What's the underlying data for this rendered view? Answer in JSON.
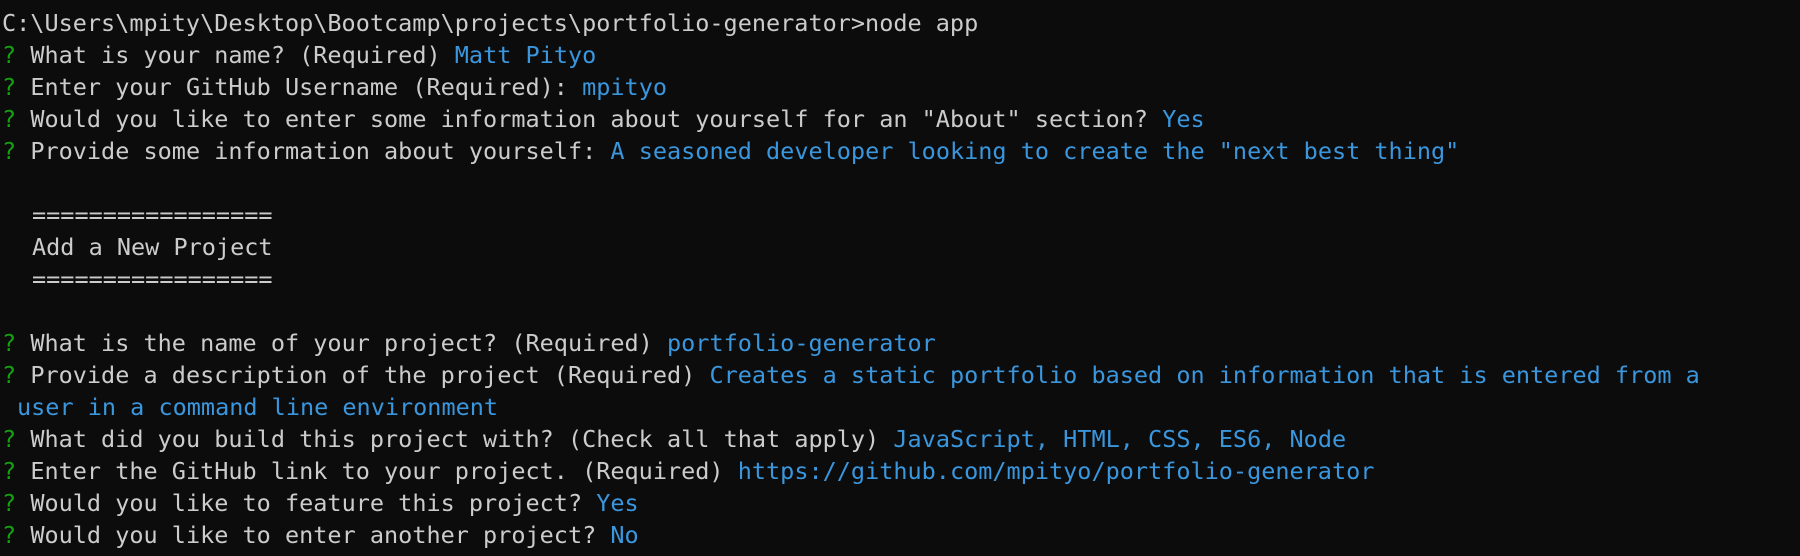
{
  "colors": {
    "background": "#0c0c0c",
    "text": "#cccccc",
    "prompt_marker": "#13a10e",
    "answer": "#3a96dd"
  },
  "terminal": {
    "command_line": "C:\\Users\\mpity\\Desktop\\Bootcamp\\projects\\portfolio-generator>node app",
    "prompt_marker": "?",
    "profile_qa": [
      {
        "question": "What is your name? (Required)",
        "answer": "Matt Pityo"
      },
      {
        "question": "Enter your GitHub Username (Required):",
        "answer": "mpityo"
      },
      {
        "question": "Would you like to enter some information about yourself for an \"About\" section?",
        "answer": "Yes"
      },
      {
        "question": "Provide some information about yourself:",
        "answer": "A seasoned developer looking to create the \"next best thing\""
      }
    ],
    "banner": {
      "rule": "=================",
      "title": "Add a New Project"
    },
    "project_qa": [
      {
        "question": "What is the name of your project? (Required)",
        "answer": "portfolio-generator"
      },
      {
        "question": "Provide a description of the project (Required)",
        "answer": "Creates a static portfolio based on information that is entered from a",
        "answer_continued": "user in a command line environment"
      },
      {
        "question": "What did you build this project with? (Check all that apply)",
        "answer": "JavaScript, HTML, CSS, ES6, Node"
      },
      {
        "question": "Enter the GitHub link to your project. (Required)",
        "answer": "https://github.com/mpityo/portfolio-generator"
      },
      {
        "question": "Would you like to feature this project?",
        "answer": "Yes"
      },
      {
        "question": "Would you like to enter another project?",
        "answer": "No"
      }
    ]
  }
}
